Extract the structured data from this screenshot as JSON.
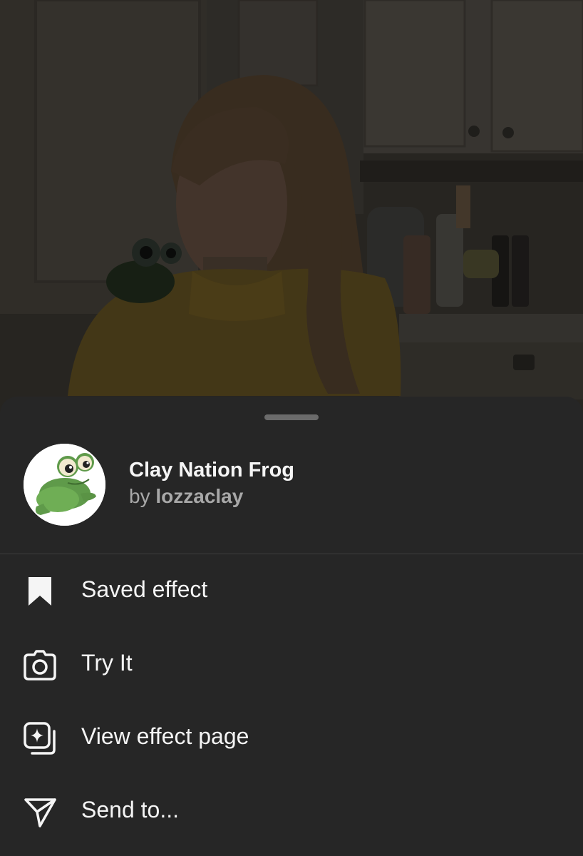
{
  "effect": {
    "title": "Clay Nation Frog",
    "by_prefix": "by",
    "author": "lozzaclay",
    "avatar_icon": "frog-effect-thumbnail"
  },
  "menu": [
    {
      "label": "Saved effect",
      "icon": "bookmark-filled-icon"
    },
    {
      "label": "Try It",
      "icon": "camera-icon"
    },
    {
      "label": "View effect page",
      "icon": "effect-sparkle-icon"
    },
    {
      "label": "Send to...",
      "icon": "send-icon"
    }
  ],
  "colors": {
    "sheet_background": "#262626",
    "primary_text": "#f5f5f5",
    "secondary_text": "#a8a8a8",
    "handle": "#6b6b6b",
    "divider": "#3d3d3d"
  }
}
